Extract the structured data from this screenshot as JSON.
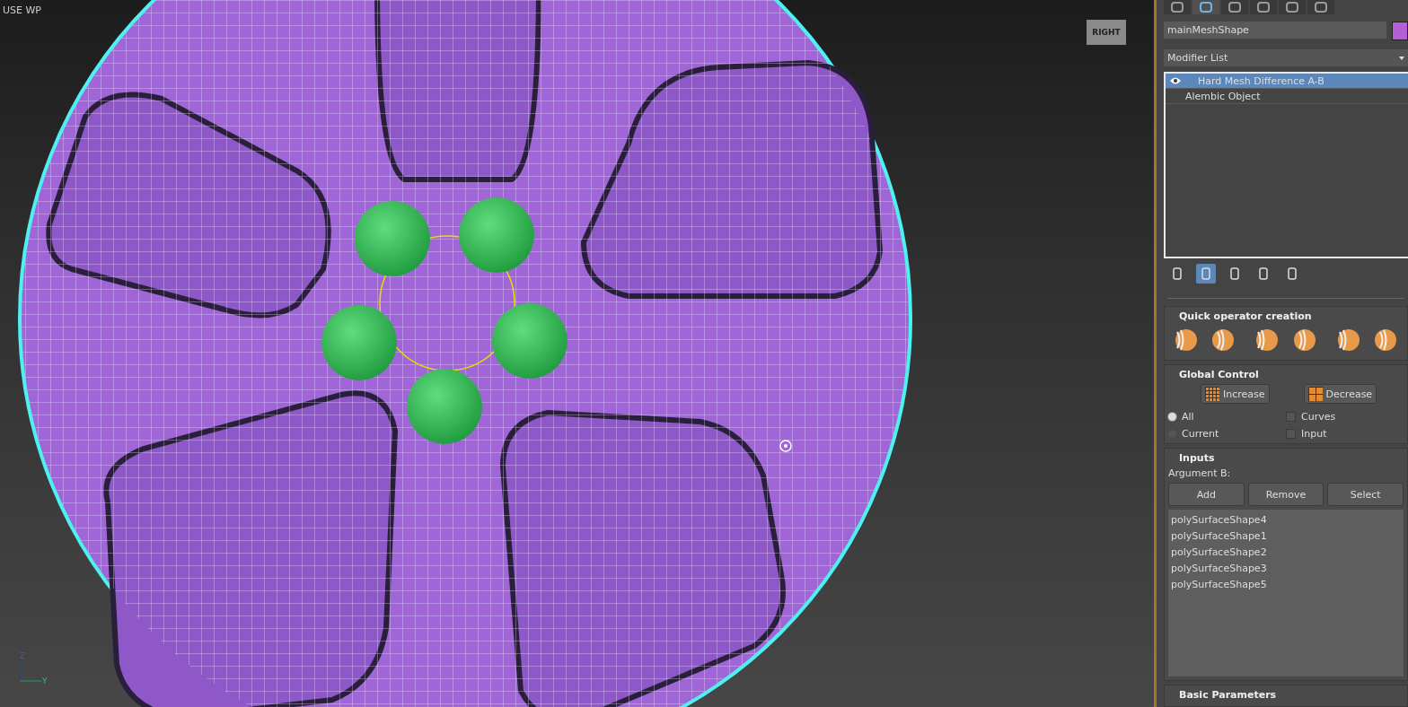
{
  "viewport": {
    "label": "USE WP",
    "viewcube": "RIGHT",
    "axes": {
      "z": "Z",
      "y": "Y"
    }
  },
  "command_tabs": [
    {
      "selected": false
    },
    {
      "selected": true
    },
    {
      "selected": false
    },
    {
      "selected": false
    },
    {
      "selected": false
    },
    {
      "selected": false
    }
  ],
  "object_name": "mainMeshShape",
  "modifier_list": "Modifier List",
  "stack": [
    {
      "label": "Hard Mesh Difference A-B",
      "selected": true,
      "on": true
    },
    {
      "label": "Alembic Object",
      "selected": false,
      "on": false
    }
  ],
  "stack_tools": [
    {
      "selected": false
    },
    {
      "selected": true
    },
    {
      "selected": false
    },
    {
      "selected": false
    },
    {
      "selected": false
    }
  ],
  "quick_operator": {
    "title": "Quick operator creation"
  },
  "global_control": {
    "title": "Global Control",
    "buttons": [
      "Increase",
      "Decrease"
    ],
    "radios": [
      {
        "label": "All",
        "selected": true
      },
      {
        "label": "Current",
        "selected": false
      }
    ],
    "checkboxes": [
      {
        "label": "Curves",
        "checked": false
      },
      {
        "label": "Input",
        "checked": false
      }
    ]
  },
  "inputs": {
    "title": "Inputs",
    "argument_label": "Argument B:",
    "buttons": [
      "Add",
      "Remove",
      "Select"
    ],
    "items": [
      "polySurfaceShape4",
      "polySurfaceShape1",
      "polySurfaceShape2",
      "polySurfaceShape3",
      "polySurfaceShape5"
    ]
  },
  "basic_parameters": {
    "title": "Basic Parameters"
  }
}
